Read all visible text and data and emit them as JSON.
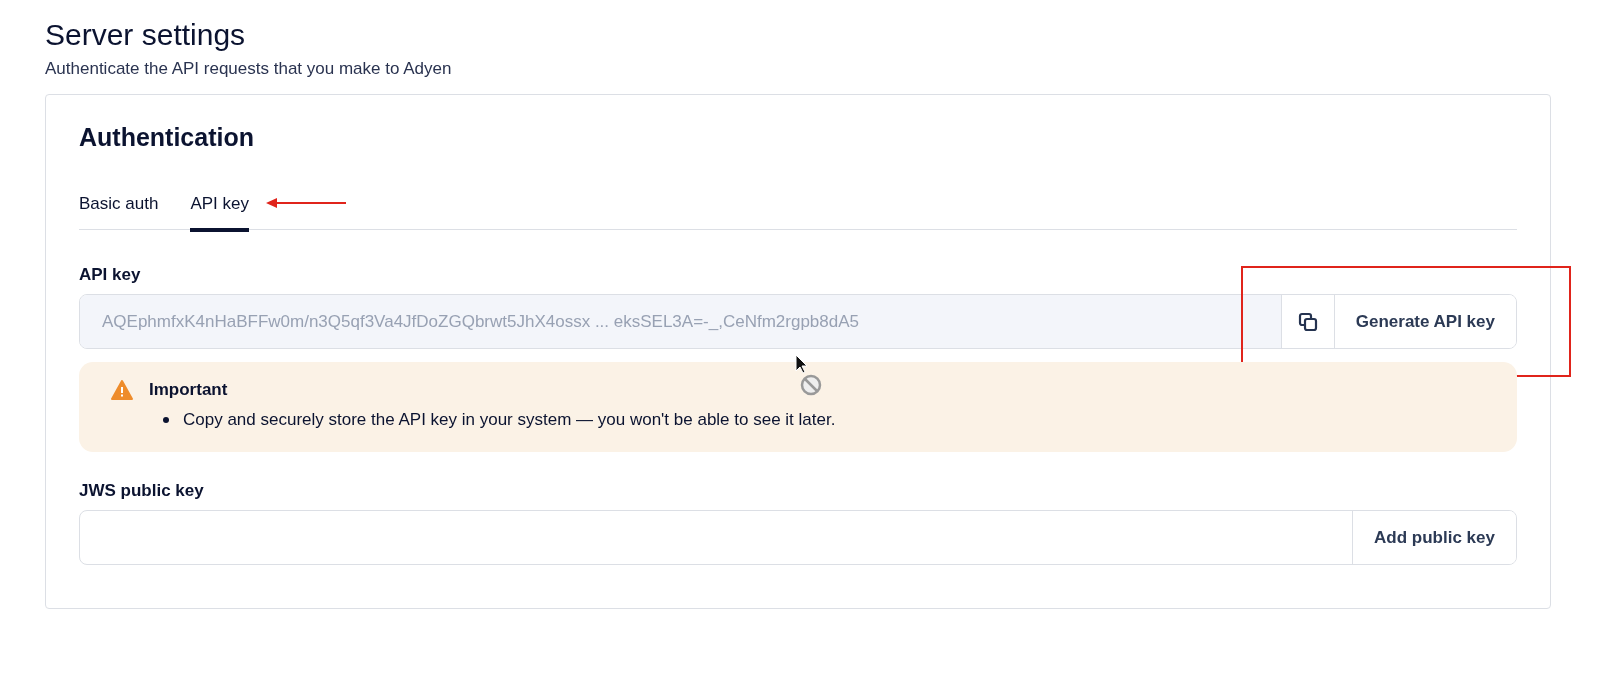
{
  "page": {
    "title": "Server settings",
    "subtitle": "Authenticate the API requests that you make to Adyen"
  },
  "card": {
    "title": "Authentication",
    "tabs": [
      {
        "label": "Basic auth",
        "selected": false
      },
      {
        "label": "API key",
        "selected": true
      }
    ],
    "api_key": {
      "label": "API key",
      "value": "AQEphmfxK4nHaBFFw0m/n3Q5qf3Va4JfDoZGQbrwt5JhX4ossx ... eksSEL3A=-_,CeNfm2rgpb8dA5",
      "button": "Generate API key"
    },
    "notice": {
      "title": "Important",
      "items": [
        "Copy and securely store the API key in your system — you won't be able to see it later."
      ]
    },
    "jws_key": {
      "label": "JWS public key",
      "button": "Add public key"
    }
  }
}
